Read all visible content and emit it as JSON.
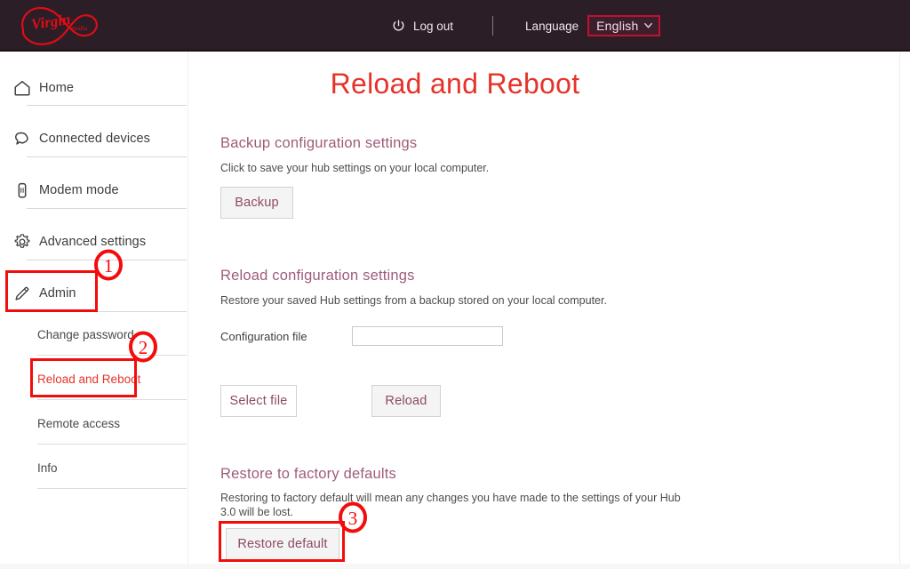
{
  "header": {
    "logo_alt": "Virgin Media",
    "logout_label": "Log out",
    "logout_icon": "power-icon",
    "language_label": "Language",
    "language_value": "English",
    "language_options": [
      "English"
    ],
    "chevron_icon": "chevron-down-icon",
    "bg_color": "#2b1e26",
    "accent_color": "#c4102e"
  },
  "sidebar": {
    "items": [
      {
        "label": "Home",
        "icon": "home-icon"
      },
      {
        "label": "Connected devices",
        "icon": "connected-devices-icon"
      },
      {
        "label": "Modem mode",
        "icon": "modem-icon"
      },
      {
        "label": "Advanced settings",
        "icon": "gear-icon"
      },
      {
        "label": "Admin",
        "icon": "pencil-icon"
      }
    ],
    "sub_items": [
      {
        "label": "Change password",
        "active": false
      },
      {
        "label": "Reload and Reboot",
        "active": true
      },
      {
        "label": "Remote access",
        "active": false
      },
      {
        "label": "Info",
        "active": false
      }
    ],
    "active_color": "#e5332a"
  },
  "main": {
    "title": "Reload and Reboot",
    "title_color": "#e5332a",
    "sections": [
      {
        "heading": "Backup configuration settings",
        "text": "Click to save your hub settings on your local computer.",
        "button": "Backup"
      },
      {
        "heading": "Reload configuration settings",
        "text": "Restore your saved Hub settings from a backup stored on your local computer.",
        "field_label": "Configuration file",
        "field_value": "",
        "field_placeholder": "",
        "select_button": "Select file",
        "reload_button": "Reload"
      },
      {
        "heading": "Restore to factory defaults",
        "text": "Restoring to factory default will mean any changes you have made to the settings of your Hub 3.0 will be lost.",
        "button": "Restore default"
      }
    ],
    "heading_color": "#9e5c7a"
  },
  "annotations": {
    "color": "#f30c0c",
    "markers": [
      {
        "number": "1",
        "target": "Admin"
      },
      {
        "number": "2",
        "target": "Reload and Reboot"
      },
      {
        "number": "3",
        "target": "Restore default"
      }
    ]
  }
}
